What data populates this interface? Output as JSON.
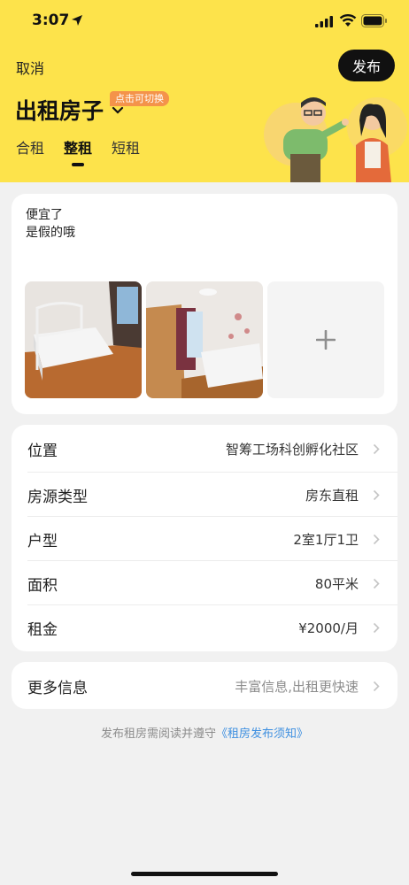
{
  "status_bar": {
    "time": "3:07"
  },
  "header": {
    "cancel_label": "取消",
    "publish_label": "发布",
    "title": "出租房子",
    "switch_badge": "点击可切换",
    "tabs": [
      {
        "label": "合租",
        "active": false
      },
      {
        "label": "整租",
        "active": true
      },
      {
        "label": "短租",
        "active": false
      }
    ]
  },
  "description": {
    "line1": "便宜了",
    "line2": "是假的哦"
  },
  "details": [
    {
      "label": "位置",
      "value": "智筹工场科创孵化社区"
    },
    {
      "label": "房源类型",
      "value": "房东直租"
    },
    {
      "label": "户型",
      "value": "2室1厅1卫"
    },
    {
      "label": "面积",
      "value": "80平米"
    },
    {
      "label": "租金",
      "value": "¥2000/月"
    }
  ],
  "more": {
    "label": "更多信息",
    "value": "丰富信息,出租更快速"
  },
  "notice": {
    "text": "发布租房需阅读并遵守",
    "link": "《租房发布须知》"
  },
  "colors": {
    "accent": "#fde34b",
    "link": "#3d8fe0",
    "badge": "#f4934a"
  }
}
